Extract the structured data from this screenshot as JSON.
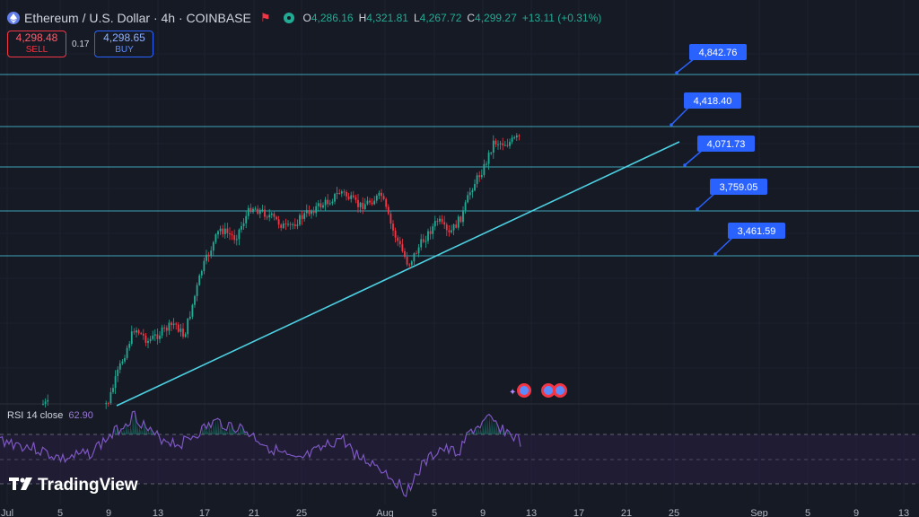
{
  "legend": {
    "title": "Ethereum / U.S. Dollar · 4h · COINBASE",
    "open_label": "O",
    "open": "4,286.16",
    "high_label": "H",
    "high": "4,321.81",
    "low_label": "L",
    "low": "4,267.72",
    "close_label": "C",
    "close": "4,299.27",
    "change": "+13.11 (+0.31%)"
  },
  "trade": {
    "sell_price": "4,298.48",
    "sell_label": "SELL",
    "spread": "0.17",
    "buy_price": "4,298.65",
    "buy_label": "BUY"
  },
  "price_levels": [
    {
      "label": "4,842.76"
    },
    {
      "label": "4,418.40"
    },
    {
      "label": "4,071.73"
    },
    {
      "label": "3,759.05"
    },
    {
      "label": "3,461.59"
    }
  ],
  "rsi": {
    "label": "RSI 14 close",
    "value": "62.90"
  },
  "time_axis": [
    "Jul",
    "5",
    "9",
    "13",
    "17",
    "21",
    "25",
    "Aug",
    "5",
    "9",
    "13",
    "17",
    "21",
    "25",
    "Sep",
    "5",
    "9",
    "13"
  ],
  "branding": {
    "name": "TradingView"
  },
  "colors": {
    "background": "#161a25",
    "up": "#22ab94",
    "down": "#f23645",
    "level_line": "#4dd0e1",
    "label_bg": "#2962ff",
    "rsi": "#7e57c2"
  }
}
